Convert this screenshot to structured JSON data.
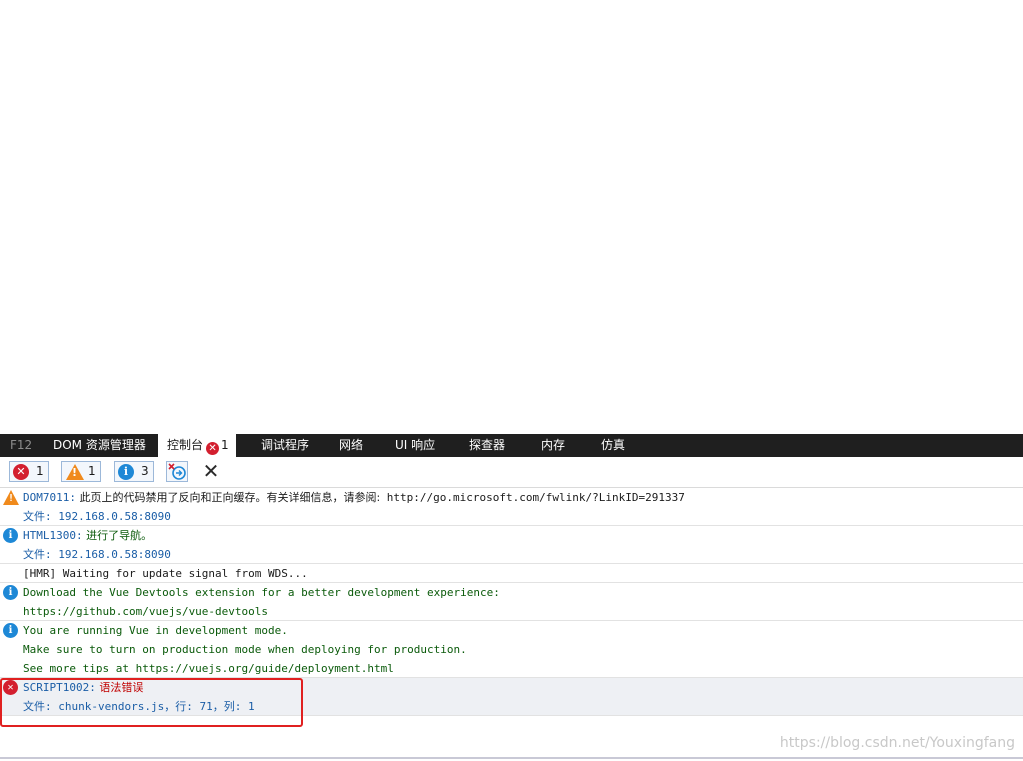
{
  "tabs": [
    {
      "label": "F12"
    },
    {
      "label": "DOM 资源管理器"
    },
    {
      "label": "控制台",
      "badge": "1"
    },
    {
      "label": "调试程序"
    },
    {
      "label": "网络"
    },
    {
      "label": "UI 响应"
    },
    {
      "label": "探查器"
    },
    {
      "label": "内存"
    },
    {
      "label": "仿真"
    }
  ],
  "toolbar": {
    "errors_count": "1",
    "warnings_count": "1",
    "info_count": "3"
  },
  "messages": [
    {
      "level": "warning",
      "code": "DOM7011:",
      "text": " 此页上的代码禁用了反向和正向缓存。有关详细信息，请参阅:",
      "link": " http://go.microsoft.com/fwlink/?LinkID=291337",
      "file": "文件: 192.168.0.58:8090"
    },
    {
      "level": "info",
      "code": "HTML1300:",
      "text": " 进行了导航。",
      "file": "文件: 192.168.0.58:8090"
    },
    {
      "level": "log",
      "text": "[HMR] Waiting for update signal from WDS..."
    },
    {
      "level": "info",
      "line1": "Download the Vue Devtools extension for a better development experience:",
      "line2": "https://github.com/vuejs/vue-devtools"
    },
    {
      "level": "info",
      "line1": "You are running Vue in development mode.",
      "line2": "Make sure to turn on production mode when deploying for production.",
      "line3": "See more tips at https://vuejs.org/guide/deployment.html"
    },
    {
      "level": "error",
      "code": "SCRIPT1002:",
      "text": " 语法错误",
      "file": "文件: chunk-vendors.js，行: 71，列: 1"
    }
  ],
  "watermark": "https://blog.csdn.net/Youxingfang",
  "colors": {
    "error": "#d31f2f",
    "warning": "#f08a1c",
    "info": "#1e88d6",
    "tabbar": "#1f1f1f",
    "highlight": "#e02020"
  }
}
